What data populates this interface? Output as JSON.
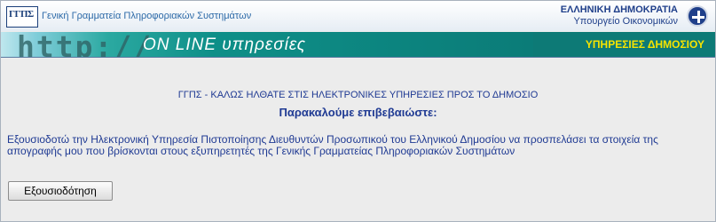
{
  "header": {
    "logo_text": "ΓΓΠΣ",
    "org_name": "Γενική Γραμματεία Πληροφοριακών Συστημάτων",
    "gov_title": "ΕΛΛΗΝΙΚΗ ΔΗΜΟΚΡΑΤΙΑ",
    "gov_subtitle": "Υπουργείο Οικονομικών",
    "banner_http": "http://",
    "banner_online": "ON LINE υπηρεσίες",
    "department": "ΥΠΗΡΕΣΙΕΣ ΔΗΜΟΣΙΟΥ"
  },
  "main": {
    "welcome": "ΓΓΠΣ - ΚΑΛΩΣ ΗΛΘΑΤΕ ΣΤΙΣ ΗΛΕΚΤΡΟΝΙΚΕΣ ΥΠΗΡΕΣΙΕΣ ΠΡΟΣ ΤΟ ΔΗΜΟΣΙΟ",
    "confirm": "Παρακαλούμε επιβεβαιώστε:",
    "authorization_text": "Εξουσιοδοτώ την Ηλεκτρονική Υπηρεσία Πιστοποίησης Διευθυντών Προσωπικού του Ελληνικού Δημοσίου να προσπελάσει τα στοιχεία της απογραφής μου που βρίσκονται στους εξυπηρετητές της Γενικής Γραμματείας Πληροφοριακών Συστημάτων",
    "authorize_button": "Εξουσιοδότηση"
  }
}
